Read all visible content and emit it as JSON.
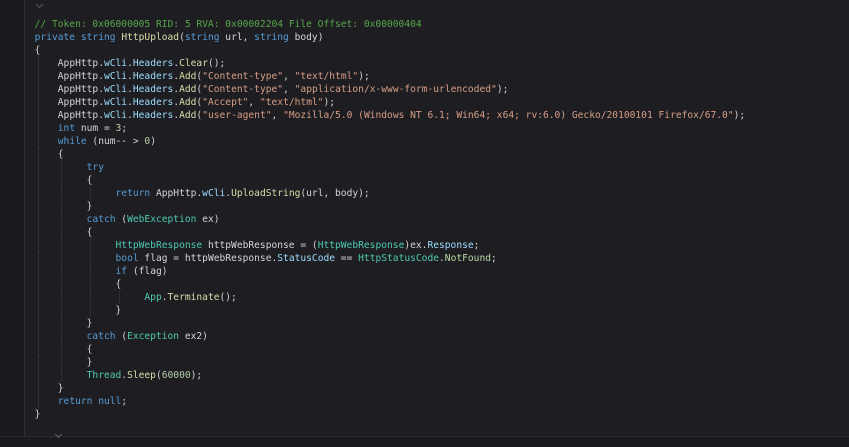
{
  "editor": {
    "lines": [
      {
        "indent": 6,
        "tokens": [
          {
            "t": "comment",
            "v": "// Token: 0x06000005 RID: 5 RVA: 0x00002204 File Offset: 0x00000404"
          }
        ]
      },
      {
        "indent": 6,
        "tokens": [
          {
            "t": "keyword",
            "v": "private"
          },
          {
            "t": "punct",
            "v": " "
          },
          {
            "t": "keyword",
            "v": "string"
          },
          {
            "t": "punct",
            "v": " "
          },
          {
            "t": "method",
            "v": "HttpUpload"
          },
          {
            "t": "punct",
            "v": "("
          },
          {
            "t": "keyword",
            "v": "string"
          },
          {
            "t": "ident",
            "v": " url, "
          },
          {
            "t": "keyword",
            "v": "string"
          },
          {
            "t": "ident",
            "v": " body)"
          }
        ]
      },
      {
        "indent": 6,
        "tokens": [
          {
            "t": "punct",
            "v": "{"
          }
        ]
      },
      {
        "indent": 10,
        "tokens": [
          {
            "t": "ident",
            "v": "AppHttp."
          },
          {
            "t": "prop",
            "v": "wCli"
          },
          {
            "t": "ident",
            "v": "."
          },
          {
            "t": "prop",
            "v": "Headers"
          },
          {
            "t": "ident",
            "v": "."
          },
          {
            "t": "method",
            "v": "Clear"
          },
          {
            "t": "ident",
            "v": "();"
          }
        ]
      },
      {
        "indent": 10,
        "tokens": [
          {
            "t": "ident",
            "v": "AppHttp."
          },
          {
            "t": "prop",
            "v": "wCli"
          },
          {
            "t": "ident",
            "v": "."
          },
          {
            "t": "prop",
            "v": "Headers"
          },
          {
            "t": "ident",
            "v": "."
          },
          {
            "t": "method",
            "v": "Add"
          },
          {
            "t": "ident",
            "v": "("
          },
          {
            "t": "string",
            "v": "\"Content-type\""
          },
          {
            "t": "ident",
            "v": ", "
          },
          {
            "t": "string",
            "v": "\"text/html\""
          },
          {
            "t": "ident",
            "v": ");"
          }
        ]
      },
      {
        "indent": 10,
        "tokens": [
          {
            "t": "ident",
            "v": "AppHttp."
          },
          {
            "t": "prop",
            "v": "wCli"
          },
          {
            "t": "ident",
            "v": "."
          },
          {
            "t": "prop",
            "v": "Headers"
          },
          {
            "t": "ident",
            "v": "."
          },
          {
            "t": "method",
            "v": "Add"
          },
          {
            "t": "ident",
            "v": "("
          },
          {
            "t": "string",
            "v": "\"Content-type\""
          },
          {
            "t": "ident",
            "v": ", "
          },
          {
            "t": "string",
            "v": "\"application/x-www-form-urlencoded\""
          },
          {
            "t": "ident",
            "v": ");"
          }
        ]
      },
      {
        "indent": 10,
        "tokens": [
          {
            "t": "ident",
            "v": "AppHttp."
          },
          {
            "t": "prop",
            "v": "wCli"
          },
          {
            "t": "ident",
            "v": "."
          },
          {
            "t": "prop",
            "v": "Headers"
          },
          {
            "t": "ident",
            "v": "."
          },
          {
            "t": "method",
            "v": "Add"
          },
          {
            "t": "ident",
            "v": "("
          },
          {
            "t": "string",
            "v": "\"Accept\""
          },
          {
            "t": "ident",
            "v": ", "
          },
          {
            "t": "string",
            "v": "\"text/html\""
          },
          {
            "t": "ident",
            "v": ");"
          }
        ]
      },
      {
        "indent": 10,
        "tokens": [
          {
            "t": "ident",
            "v": "AppHttp."
          },
          {
            "t": "prop",
            "v": "wCli"
          },
          {
            "t": "ident",
            "v": "."
          },
          {
            "t": "prop",
            "v": "Headers"
          },
          {
            "t": "ident",
            "v": "."
          },
          {
            "t": "method",
            "v": "Add"
          },
          {
            "t": "ident",
            "v": "("
          },
          {
            "t": "string",
            "v": "\"user-agent\""
          },
          {
            "t": "ident",
            "v": ", "
          },
          {
            "t": "string",
            "v": "\"Mozilla/5.0 (Windows NT 6.1; Win64; x64; rv:6.0) Gecko/20100101 Firefox/67.0\""
          },
          {
            "t": "ident",
            "v": ");"
          }
        ]
      },
      {
        "indent": 10,
        "tokens": [
          {
            "t": "keyword",
            "v": "int"
          },
          {
            "t": "ident",
            "v": " num = "
          },
          {
            "t": "number",
            "v": "3"
          },
          {
            "t": "ident",
            "v": ";"
          }
        ]
      },
      {
        "indent": 10,
        "tokens": [
          {
            "t": "keyword",
            "v": "while"
          },
          {
            "t": "ident",
            "v": " (num-- > "
          },
          {
            "t": "number",
            "v": "0"
          },
          {
            "t": "ident",
            "v": ")"
          }
        ]
      },
      {
        "indent": 10,
        "tokens": [
          {
            "t": "punct",
            "v": "{"
          }
        ]
      },
      {
        "indent": 15,
        "tokens": [
          {
            "t": "keyword",
            "v": "try"
          }
        ]
      },
      {
        "indent": 15,
        "tokens": [
          {
            "t": "punct",
            "v": "{"
          }
        ]
      },
      {
        "indent": 20,
        "tokens": [
          {
            "t": "keyword",
            "v": "return"
          },
          {
            "t": "ident",
            "v": " AppHttp."
          },
          {
            "t": "prop",
            "v": "wCli"
          },
          {
            "t": "ident",
            "v": "."
          },
          {
            "t": "method",
            "v": "UploadString"
          },
          {
            "t": "ident",
            "v": "(url, body);"
          }
        ]
      },
      {
        "indent": 15,
        "tokens": [
          {
            "t": "punct",
            "v": "}"
          }
        ]
      },
      {
        "indent": 15,
        "tokens": [
          {
            "t": "keyword",
            "v": "catch"
          },
          {
            "t": "ident",
            "v": " ("
          },
          {
            "t": "type",
            "v": "WebException"
          },
          {
            "t": "ident",
            "v": " ex)"
          }
        ]
      },
      {
        "indent": 15,
        "tokens": [
          {
            "t": "punct",
            "v": "{"
          }
        ]
      },
      {
        "indent": 20,
        "tokens": [
          {
            "t": "type",
            "v": "HttpWebResponse"
          },
          {
            "t": "ident",
            "v": " httpWebResponse = ("
          },
          {
            "t": "type",
            "v": "HttpWebResponse"
          },
          {
            "t": "ident",
            "v": ")ex."
          },
          {
            "t": "prop",
            "v": "Response"
          },
          {
            "t": "ident",
            "v": ";"
          }
        ]
      },
      {
        "indent": 20,
        "tokens": [
          {
            "t": "keyword",
            "v": "bool"
          },
          {
            "t": "ident",
            "v": " flag = httpWebResponse."
          },
          {
            "t": "prop",
            "v": "StatusCode"
          },
          {
            "t": "ident",
            "v": " == "
          },
          {
            "t": "type",
            "v": "HttpStatusCode"
          },
          {
            "t": "ident",
            "v": "."
          },
          {
            "t": "enum",
            "v": "NotFound"
          },
          {
            "t": "ident",
            "v": ";"
          }
        ]
      },
      {
        "indent": 20,
        "tokens": [
          {
            "t": "keyword",
            "v": "if"
          },
          {
            "t": "ident",
            "v": " (flag)"
          }
        ]
      },
      {
        "indent": 20,
        "tokens": [
          {
            "t": "punct",
            "v": "{"
          }
        ]
      },
      {
        "indent": 25,
        "tokens": [
          {
            "t": "type",
            "v": "App"
          },
          {
            "t": "ident",
            "v": "."
          },
          {
            "t": "method",
            "v": "Terminate"
          },
          {
            "t": "ident",
            "v": "();"
          }
        ]
      },
      {
        "indent": 20,
        "tokens": [
          {
            "t": "punct",
            "v": "}"
          }
        ]
      },
      {
        "indent": 15,
        "tokens": [
          {
            "t": "punct",
            "v": "}"
          }
        ]
      },
      {
        "indent": 15,
        "tokens": [
          {
            "t": "keyword",
            "v": "catch"
          },
          {
            "t": "ident",
            "v": " ("
          },
          {
            "t": "type",
            "v": "Exception"
          },
          {
            "t": "ident",
            "v": " ex2)"
          }
        ]
      },
      {
        "indent": 15,
        "tokens": [
          {
            "t": "punct",
            "v": "{"
          }
        ]
      },
      {
        "indent": 15,
        "tokens": [
          {
            "t": "punct",
            "v": "}"
          }
        ]
      },
      {
        "indent": 15,
        "tokens": [
          {
            "t": "type",
            "v": "Thread"
          },
          {
            "t": "ident",
            "v": "."
          },
          {
            "t": "method",
            "v": "Sleep"
          },
          {
            "t": "ident",
            "v": "("
          },
          {
            "t": "number",
            "v": "60000"
          },
          {
            "t": "ident",
            "v": ");"
          }
        ]
      },
      {
        "indent": 10,
        "tokens": [
          {
            "t": "punct",
            "v": "}"
          }
        ]
      },
      {
        "indent": 10,
        "tokens": [
          {
            "t": "keyword",
            "v": "return"
          },
          {
            "t": "ident",
            "v": " "
          },
          {
            "t": "keyword",
            "v": "null"
          },
          {
            "t": "ident",
            "v": ";"
          }
        ]
      },
      {
        "indent": 6,
        "tokens": [
          {
            "t": "punct",
            "v": "}"
          }
        ]
      }
    ]
  },
  "colors": {
    "background": "#1e1e22",
    "comment": "#57a64a",
    "keyword": "#569cd6",
    "method": "#dcdcaa",
    "type": "#4ec9b0",
    "string": "#d69d85",
    "number": "#b5cea8"
  }
}
